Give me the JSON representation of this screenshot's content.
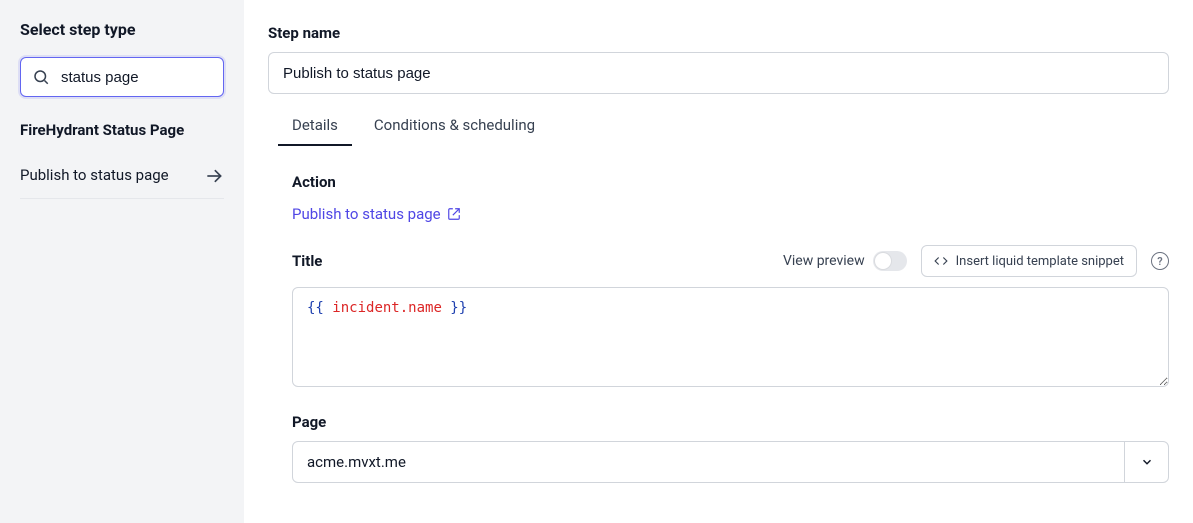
{
  "sidebar": {
    "title": "Select step type",
    "search_value": "status page",
    "search_placeholder": "",
    "results_header": "FireHydrant Status Page",
    "results": [
      {
        "label": "Publish to status page"
      }
    ]
  },
  "main": {
    "step_name_label": "Step name",
    "step_name_value": "Publish to status page",
    "tabs": [
      {
        "label": "Details",
        "active": true
      },
      {
        "label": "Conditions & scheduling",
        "active": false
      }
    ],
    "action": {
      "label": "Action",
      "link_text": "Publish to status page"
    },
    "title": {
      "label": "Title",
      "view_preview_label": "View preview",
      "snippet_button_label": "Insert liquid template snippet",
      "value_tokens": [
        {
          "cls": "tok-brace",
          "t": "{{ "
        },
        {
          "cls": "tok-var",
          "t": "incident.name"
        },
        {
          "cls": "tok-brace",
          "t": " }}"
        }
      ]
    },
    "page": {
      "label": "Page",
      "selected": "acme.mvxt.me"
    }
  }
}
